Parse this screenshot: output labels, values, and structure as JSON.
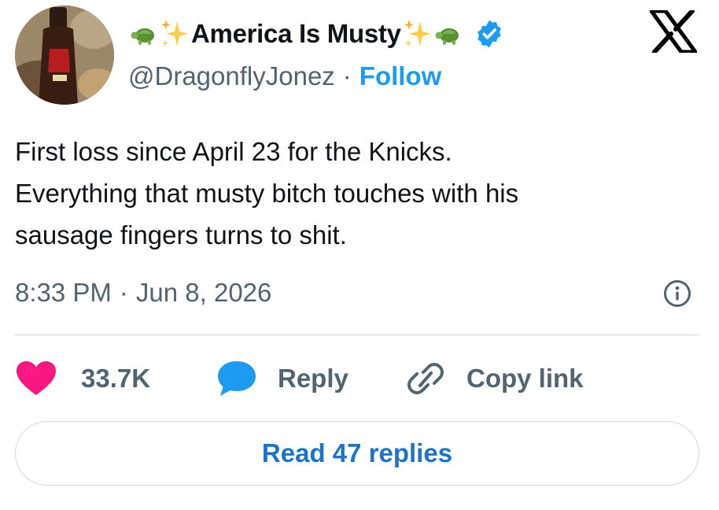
{
  "author": {
    "display_name": "America Is Musty",
    "handle": "@DragonflyJonez",
    "follow_label": "Follow",
    "name_emojis": [
      "turtle-icon",
      "sparkles-icon",
      "sparkles-icon",
      "turtle-icon"
    ],
    "verified": true
  },
  "tweet": {
    "lines": [
      "First loss since April 23 for the Knicks.",
      "Everything that musty bitch touches with his",
      "sausage fingers turns to shit."
    ],
    "time": "8:33 PM",
    "date": "Jun 8, 2026"
  },
  "actions": {
    "like_count": "33.7K",
    "reply_label": "Reply",
    "copy_link_label": "Copy link"
  },
  "read_replies_label": "Read 47 replies",
  "colors": {
    "accent": "#1d9bf0",
    "like": "#f91880",
    "reply_bubble": "#1d9bf0",
    "muted_text": "#536471",
    "read_replies": "#1d73c9"
  },
  "icons": {
    "logo": "x-logo-icon",
    "info": "info-icon",
    "heart": "heart-icon",
    "reply": "speech-bubble-icon",
    "copy": "link-icon"
  }
}
